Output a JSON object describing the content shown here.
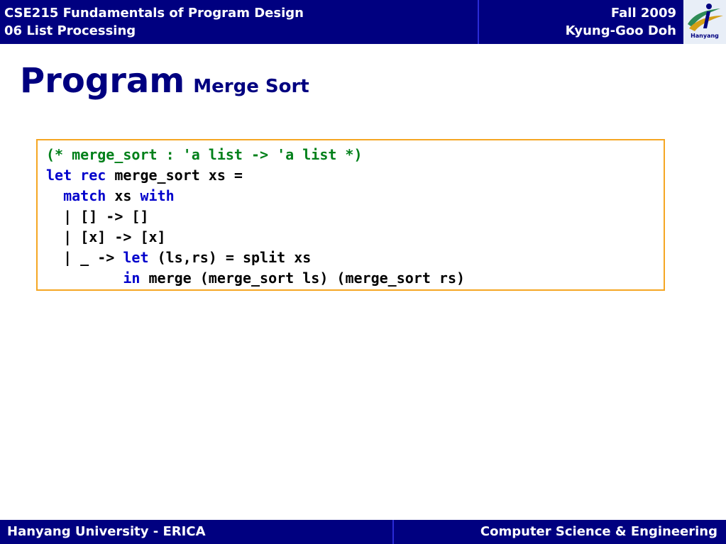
{
  "header": {
    "course": "CSE215 Fundamentals of Program Design",
    "chapter": "06 List Processing",
    "term": "Fall 2009",
    "instructor": "Kyung-Goo Doh",
    "logo_text": "Hanyang"
  },
  "title": {
    "main": "Program",
    "sub": "Merge Sort"
  },
  "code": {
    "l1": "(* merge_sort : 'a list -> 'a list *)",
    "l2_kw1": "let",
    "l2_kw2": "rec",
    "l2_rest": "merge_sort xs =",
    "l3_kw1": "match",
    "l3_mid": "xs",
    "l3_kw2": "with",
    "l4": "| [] -> []",
    "l5": "| [x] -> [x]",
    "l6_pre": "| _ ->",
    "l6_kw": "let",
    "l6_rest": "(ls,rs) = split xs",
    "l7_kw": "in",
    "l7_rest": "merge (merge_sort ls) (merge_sort rs)"
  },
  "footer": {
    "left": "Hanyang University - ERICA",
    "right": "Computer Science & Engineering"
  },
  "colors": {
    "header_bg": "#000080",
    "keyword": "#0000cc",
    "comment": "#00801a",
    "code_border": "#f5a623"
  }
}
